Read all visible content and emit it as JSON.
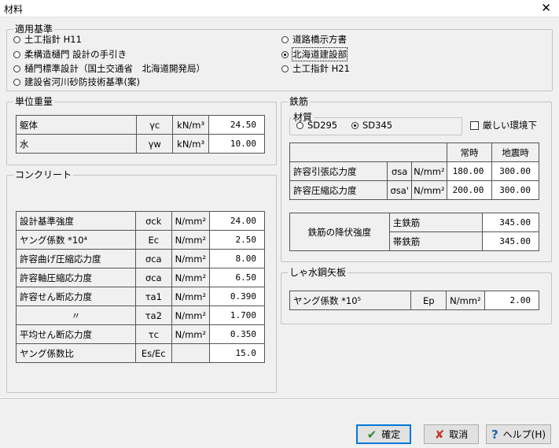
{
  "window": {
    "title": "材料",
    "close_glyph": "✕"
  },
  "standards": {
    "legend": "適用基準",
    "options": [
      {
        "label": "土工指針 H11",
        "selected": false
      },
      {
        "label": "柔構造樋門 設計の手引き",
        "selected": false
      },
      {
        "label": "樋門標準設計（国土交通省　北海道開発局）",
        "selected": false
      },
      {
        "label": "建設省河川砂防技術基準(案)",
        "selected": false
      },
      {
        "label": "道路橋示方書",
        "selected": false
      },
      {
        "label": "北海道建設部",
        "selected": true
      },
      {
        "label": "土工指針 H21",
        "selected": false
      }
    ]
  },
  "unit_weight": {
    "legend": "単位重量",
    "rows": [
      {
        "name": "躯体",
        "symbol": "γc",
        "unit": "kN/m³",
        "value": "24.50"
      },
      {
        "name": "水",
        "symbol": "γw",
        "unit": "kN/m³",
        "value": "10.00"
      }
    ]
  },
  "concrete": {
    "legend": "コンクリート",
    "rows": [
      {
        "name": "設計基準強度",
        "symbol": "σck",
        "unit": "N/mm²",
        "value": "24.00"
      },
      {
        "name": "ヤング係数 *10⁴",
        "symbol": "Ec",
        "unit": "N/mm²",
        "value": "2.50"
      },
      {
        "name": "許容曲げ圧縮応力度",
        "symbol": "σca",
        "unit": "N/mm²",
        "value": "8.00"
      },
      {
        "name": "許容軸圧縮応力度",
        "symbol": "σca",
        "unit": "N/mm²",
        "value": "6.50"
      },
      {
        "name": "許容せん断応力度",
        "symbol": "τa1",
        "unit": "N/mm²",
        "value": "0.390"
      },
      {
        "name": "〃",
        "symbol": "τa2",
        "unit": "N/mm²",
        "value": "1.700"
      },
      {
        "name": "平均せん断応力度",
        "symbol": "τc",
        "unit": "N/mm²",
        "value": "0.350"
      },
      {
        "name": "ヤング係数比",
        "symbol": "Es/Ec",
        "unit": "",
        "value": "15.0"
      }
    ]
  },
  "rebar": {
    "legend": "鉄筋",
    "material_legend": "材質",
    "materials": [
      {
        "label": "SD295",
        "selected": false
      },
      {
        "label": "SD345",
        "selected": true
      }
    ],
    "harsh_env_label": "厳しい環境下",
    "harsh_env_checked": false,
    "stress_headers": [
      "常時",
      "地震時"
    ],
    "stress_rows": [
      {
        "name": "許容引張応力度",
        "symbol": "σsa",
        "unit": "N/mm²",
        "normal": "180.00",
        "seismic": "300.00"
      },
      {
        "name": "許容圧縮応力度",
        "symbol": "σsa'",
        "unit": "N/mm²",
        "normal": "200.00",
        "seismic": "300.00"
      }
    ],
    "yield": {
      "name": "鉄筋の降伏強度",
      "rows": [
        {
          "label": "主鉄筋",
          "value": "345.00"
        },
        {
          "label": "帯鉄筋",
          "value": "345.00"
        }
      ]
    }
  },
  "sheet_pile": {
    "legend": "しゃ水鋼矢板",
    "row": {
      "name": "ヤング係数 *10⁵",
      "symbol": "Ep",
      "unit": "N/mm²",
      "value": "2.00"
    }
  },
  "buttons": {
    "ok": {
      "label": "確定",
      "icon": "✔"
    },
    "cancel": {
      "label": "取消",
      "icon": "✘"
    },
    "help": {
      "label": "ヘルプ(H)",
      "icon": "?"
    }
  }
}
